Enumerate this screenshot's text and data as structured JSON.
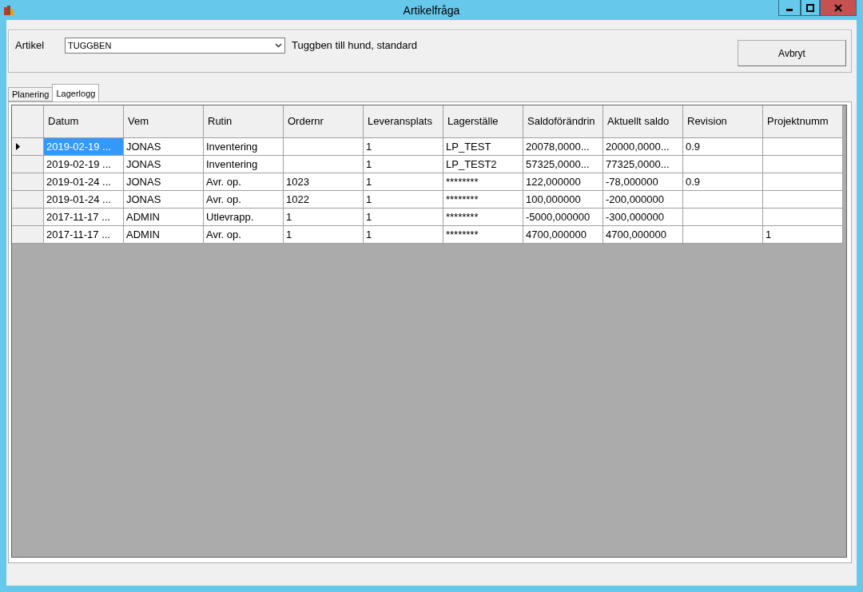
{
  "window": {
    "title": "Artikelfråga"
  },
  "article": {
    "label": "Artikel",
    "value": "TUGGBEN",
    "description": "Tuggben till hund, standard"
  },
  "cancel_button": "Avbryt",
  "tabs": [
    {
      "label": "Planering",
      "selected": false
    },
    {
      "label": "Lagerlogg",
      "selected": true
    }
  ],
  "table": {
    "columns": [
      "Datum",
      "Vem",
      "Rutin",
      "Ordernr",
      "Leveransplats",
      "Lagerställe",
      "Saldoförändrin",
      "Aktuellt saldo",
      "Revision",
      "Projektnumm"
    ],
    "rows": [
      {
        "selected": true,
        "cells": [
          "2019-02-19 ...",
          "JONAS",
          "Inventering",
          "",
          "1",
          "LP_TEST",
          "20078,0000...",
          "20000,0000...",
          "0.9",
          ""
        ]
      },
      {
        "selected": false,
        "cells": [
          "2019-02-19 ...",
          "JONAS",
          "Inventering",
          "",
          "1",
          "LP_TEST2",
          "57325,0000...",
          "77325,0000...",
          "",
          ""
        ]
      },
      {
        "selected": false,
        "cells": [
          "2019-01-24 ...",
          "JONAS",
          "Avr. op.",
          "1023",
          "1",
          "********",
          "122,000000",
          "-78,000000",
          "0.9",
          ""
        ]
      },
      {
        "selected": false,
        "cells": [
          "2019-01-24 ...",
          "JONAS",
          "Avr. op.",
          "1022",
          "1",
          "********",
          "100,000000",
          "-200,000000",
          "",
          ""
        ]
      },
      {
        "selected": false,
        "cells": [
          "2017-11-17 ...",
          "ADMIN",
          "Utlevrapp.",
          "1",
          "1",
          "********",
          "-5000,000000",
          "-300,000000",
          "",
          ""
        ]
      },
      {
        "selected": false,
        "cells": [
          "2017-11-17 ...",
          "ADMIN",
          "Avr. op.",
          "1",
          "1",
          "********",
          "4700,000000",
          "4700,000000",
          "",
          "1"
        ]
      }
    ]
  }
}
